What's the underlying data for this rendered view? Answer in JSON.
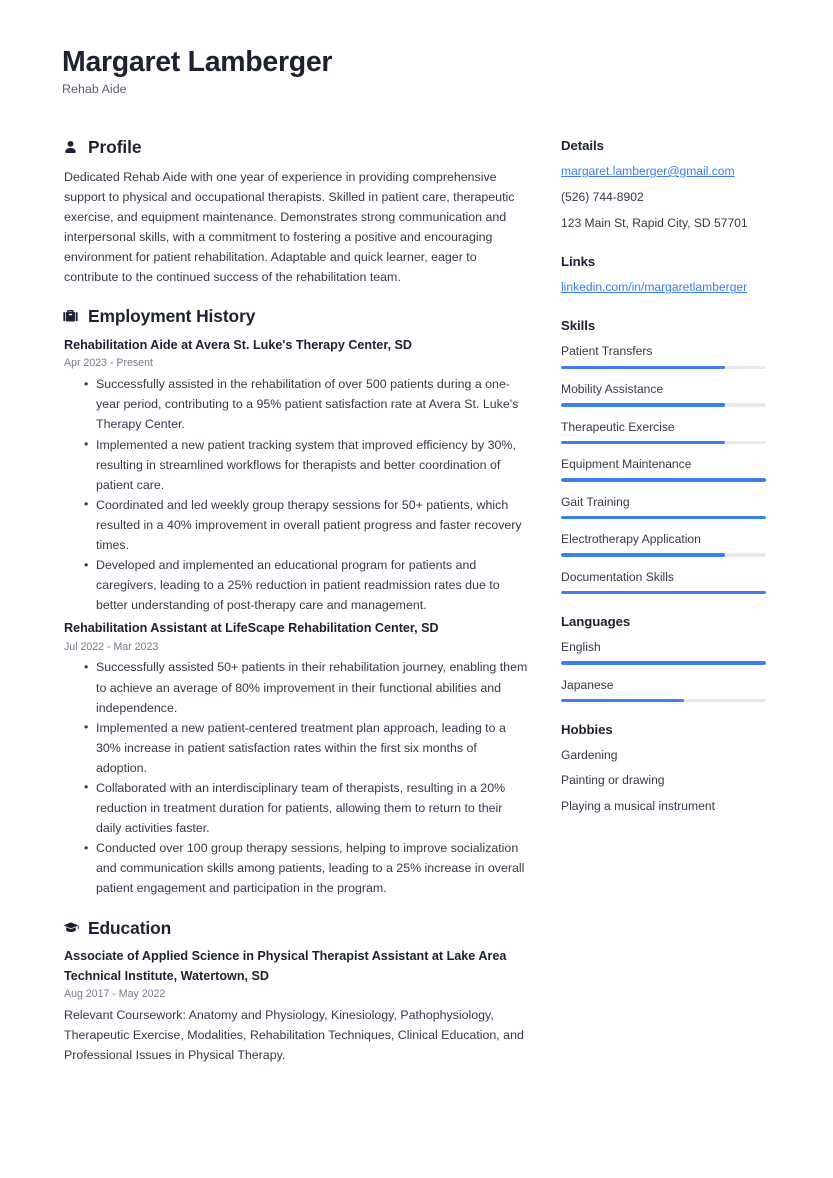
{
  "header": {
    "name": "Margaret Lamberger",
    "job_title": "Rehab Aide"
  },
  "accent_color": "#3b7ff5",
  "link_color": "#3b7bf0",
  "heading_color": "#1a2233",
  "main": {
    "profile": {
      "icon": "user-icon",
      "title": "Profile",
      "text": "Dedicated Rehab Aide with one year of experience in providing comprehensive support to physical and occupational therapists. Skilled in patient care, therapeutic exercise, and equipment maintenance. Demonstrates strong communication and interpersonal skills, with a commitment to fostering a positive and encouraging environment for patient rehabilitation. Adaptable and quick learner, eager to contribute to the continued success of the rehabilitation team."
    },
    "employment": {
      "icon": "briefcase-icon",
      "title": "Employment History",
      "entries": [
        {
          "title": "Rehabilitation Aide at Avera St. Luke's Therapy Center, SD",
          "date": "Apr 2023 - Present",
          "bullets": [
            "Successfully assisted in the rehabilitation of over 500 patients during a one-year period, contributing to a 95% patient satisfaction rate at Avera St. Luke's Therapy Center.",
            "Implemented a new patient tracking system that improved efficiency by 30%, resulting in streamlined workflows for therapists and better coordination of patient care.",
            "Coordinated and led weekly group therapy sessions for 50+ patients, which resulted in a 40% improvement in overall patient progress and faster recovery times.",
            "Developed and implemented an educational program for patients and caregivers, leading to a 25% reduction in patient readmission rates due to better understanding of post-therapy care and management."
          ]
        },
        {
          "title": "Rehabilitation Assistant at LifeScape Rehabilitation Center, SD",
          "date": "Jul 2022 - Mar 2023",
          "bullets": [
            "Successfully assisted 50+ patients in their rehabilitation journey, enabling them to achieve an average of 80% improvement in their functional abilities and independence.",
            "Implemented a new patient-centered treatment plan approach, leading to a 30% increase in patient satisfaction rates within the first six months of adoption.",
            "Collaborated with an interdisciplinary team of therapists, resulting in a 20% reduction in treatment duration for patients, allowing them to return to their daily activities faster.",
            "Conducted over 100 group therapy sessions, helping to improve socialization and communication skills among patients, leading to a 25% increase in overall patient engagement and participation in the program."
          ]
        }
      ]
    },
    "education": {
      "icon": "graduation-cap-icon",
      "title": "Education",
      "entries": [
        {
          "title": "Associate of Applied Science in Physical Therapist Assistant at Lake Area Technical Institute, Watertown, SD",
          "date": "Aug 2017 - May 2022",
          "description": "Relevant Coursework: Anatomy and Physiology, Kinesiology, Pathophysiology, Therapeutic Exercise, Modalities, Rehabilitation Techniques, Clinical Education, and Professional Issues in Physical Therapy."
        }
      ]
    }
  },
  "sidebar": {
    "details": {
      "title": "Details",
      "email": "margaret.lamberger@gmail.com",
      "phone": "(526) 744-8902",
      "address": "123 Main St, Rapid City, SD 57701"
    },
    "links": {
      "title": "Links",
      "items": [
        {
          "label": "linkedin.com/in/margaretlamberger"
        }
      ]
    },
    "skills": {
      "title": "Skills",
      "items": [
        {
          "label": "Patient Transfers",
          "level": 80
        },
        {
          "label": "Mobility Assistance",
          "level": 80
        },
        {
          "label": "Therapeutic Exercise",
          "level": 80
        },
        {
          "label": "Equipment Maintenance",
          "level": 100
        },
        {
          "label": "Gait Training",
          "level": 100
        },
        {
          "label": "Electrotherapy Application",
          "level": 80
        },
        {
          "label": "Documentation Skills",
          "level": 100
        }
      ]
    },
    "languages": {
      "title": "Languages",
      "items": [
        {
          "label": "English",
          "level": 100
        },
        {
          "label": "Japanese",
          "level": 60
        }
      ]
    },
    "hobbies": {
      "title": "Hobbies",
      "items": [
        {
          "label": "Gardening"
        },
        {
          "label": "Painting or drawing"
        },
        {
          "label": "Playing a musical instrument"
        }
      ]
    }
  }
}
